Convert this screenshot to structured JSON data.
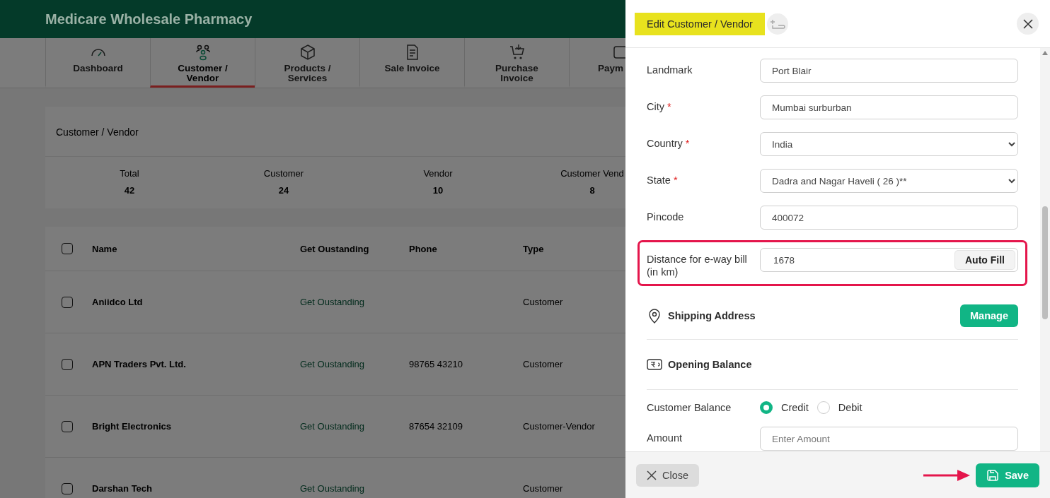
{
  "app": {
    "title": "Medicare Wholesale Pharmacy"
  },
  "nav_tabs": [
    {
      "label": "Dashboard",
      "selected": false
    },
    {
      "label": "Customer / Vendor",
      "selected": true
    },
    {
      "label": "Products / Services",
      "selected": false
    },
    {
      "label": "Sale Invoice",
      "selected": false
    },
    {
      "label": "Purchase Invoice",
      "selected": false
    },
    {
      "label": "Paym",
      "selected": false
    }
  ],
  "summary": {
    "title": "Customer / Vendor",
    "stats": [
      {
        "label": "Total",
        "value": "42"
      },
      {
        "label": "Customer",
        "value": "24"
      },
      {
        "label": "Vendor",
        "value": "10"
      },
      {
        "label": "Customer Vend",
        "value": "8"
      }
    ]
  },
  "table": {
    "select_all": {
      "checked": false
    },
    "columns": [
      "Name",
      "Get Oustanding",
      "Phone",
      "Type"
    ],
    "rows": [
      {
        "checked": false,
        "name": "Aniidco Ltd",
        "action": "Get Oustanding",
        "type": "Customer"
      },
      {
        "checked": false,
        "name": "APN Traders Pvt. Ltd.",
        "action": "Get Oustanding",
        "phone": "98765 43210",
        "type": "Customer"
      },
      {
        "checked": false,
        "name": "Bright Electronics",
        "action": "Get Oustanding",
        "phone": "87654 32109",
        "type": "Customer-Vendor"
      },
      {
        "checked": false,
        "name": "Darshan Tech",
        "action": "Get Oustanding",
        "type": "Customer"
      }
    ]
  },
  "drawer": {
    "title": "Edit Customer / Vendor",
    "fields": [
      {
        "kind": "text",
        "label": "Landmark",
        "value": "Port Blair"
      },
      {
        "kind": "text",
        "label": "City",
        "required_mark": "*",
        "value": "Mumbai surburban"
      },
      {
        "kind": "select",
        "label": "Country",
        "required_mark": "*",
        "value": "India"
      },
      {
        "kind": "select",
        "label": "State",
        "required_mark": "*",
        "value": "Dadra and Nagar Haveli ( 26 )**"
      },
      {
        "kind": "text",
        "label": "Pincode",
        "value": "400072"
      },
      {
        "kind": "distance",
        "label": "Distance for e-way bill (in km)",
        "value": "1678",
        "button": "Auto Fill",
        "highlighted": true
      }
    ],
    "shipping": {
      "title": "Shipping Address",
      "button": "Manage"
    },
    "opening_balance": {
      "title": "Opening Balance"
    },
    "balance": {
      "label": "Customer Balance",
      "options": [
        {
          "label": "Credit",
          "selected": true
        },
        {
          "label": "Debit",
          "selected": false
        }
      ]
    },
    "amount": {
      "label": "Amount",
      "placeholder": "Enter Amount"
    },
    "footer": {
      "close": "Close",
      "save": "Save"
    }
  }
}
